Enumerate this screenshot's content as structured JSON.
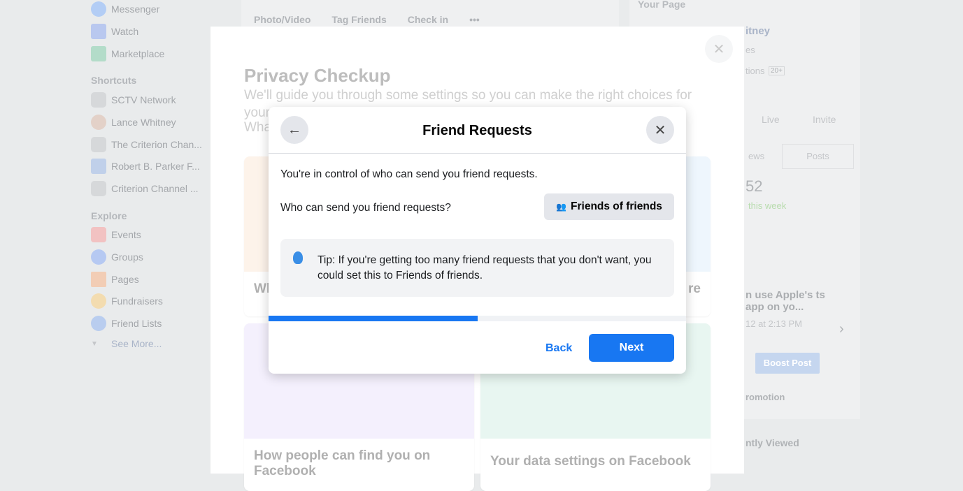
{
  "sidebar": {
    "top": [
      {
        "label": "Messenger",
        "icon": "messenger-icon"
      },
      {
        "label": "Watch",
        "icon": "watch-icon"
      },
      {
        "label": "Marketplace",
        "icon": "marketplace-icon"
      }
    ],
    "shortcuts_title": "Shortcuts",
    "shortcuts": [
      {
        "label": "SCTV Network"
      },
      {
        "label": "Lance Whitney"
      },
      {
        "label": "The Criterion Chan..."
      },
      {
        "label": "Robert B. Parker F..."
      },
      {
        "label": "Criterion Channel ..."
      }
    ],
    "explore_title": "Explore",
    "explore": [
      {
        "label": "Events"
      },
      {
        "label": "Groups"
      },
      {
        "label": "Pages"
      },
      {
        "label": "Fundraisers"
      },
      {
        "label": "Friend Lists"
      }
    ],
    "see_more": "See More..."
  },
  "composer": {
    "photo": "Photo/Video",
    "tag": "Tag Friends",
    "checkin": "Check in",
    "more": "•••"
  },
  "right_panel": {
    "title": "Your Page",
    "name": "itney",
    "sub1": "es",
    "sub2": "tions",
    "badge": "20+",
    "live": "Live",
    "invite": "Invite",
    "tab1": "ews",
    "tab2": "Posts",
    "count": "52",
    "week": "this week",
    "post_title": "n use Apple's ts app on yo...",
    "post_time": "12 at 2:13 PM",
    "boost": "Boost Post",
    "promotion": "romotion",
    "recent": "ntly Viewed"
  },
  "privacy_checkup": {
    "title": "Privacy Checkup",
    "subtitle": "We'll guide you through some settings so you can make the right choices for your account.",
    "subtitle2": "What",
    "cards": [
      "Wh",
      "re",
      "How people can find you on Facebook",
      "Your data settings on Facebook"
    ]
  },
  "dialog": {
    "title": "Friend Requests",
    "intro": "You're in control of who can send you friend requests.",
    "question": "Who can send you friend requests?",
    "selected": "Friends of friends",
    "tip": "Tip: If you're getting too many friend requests that you don't want, you could set this to Friends of friends.",
    "progress_percent": 50,
    "back": "Back",
    "next": "Next",
    "accent": "#1877f2"
  }
}
